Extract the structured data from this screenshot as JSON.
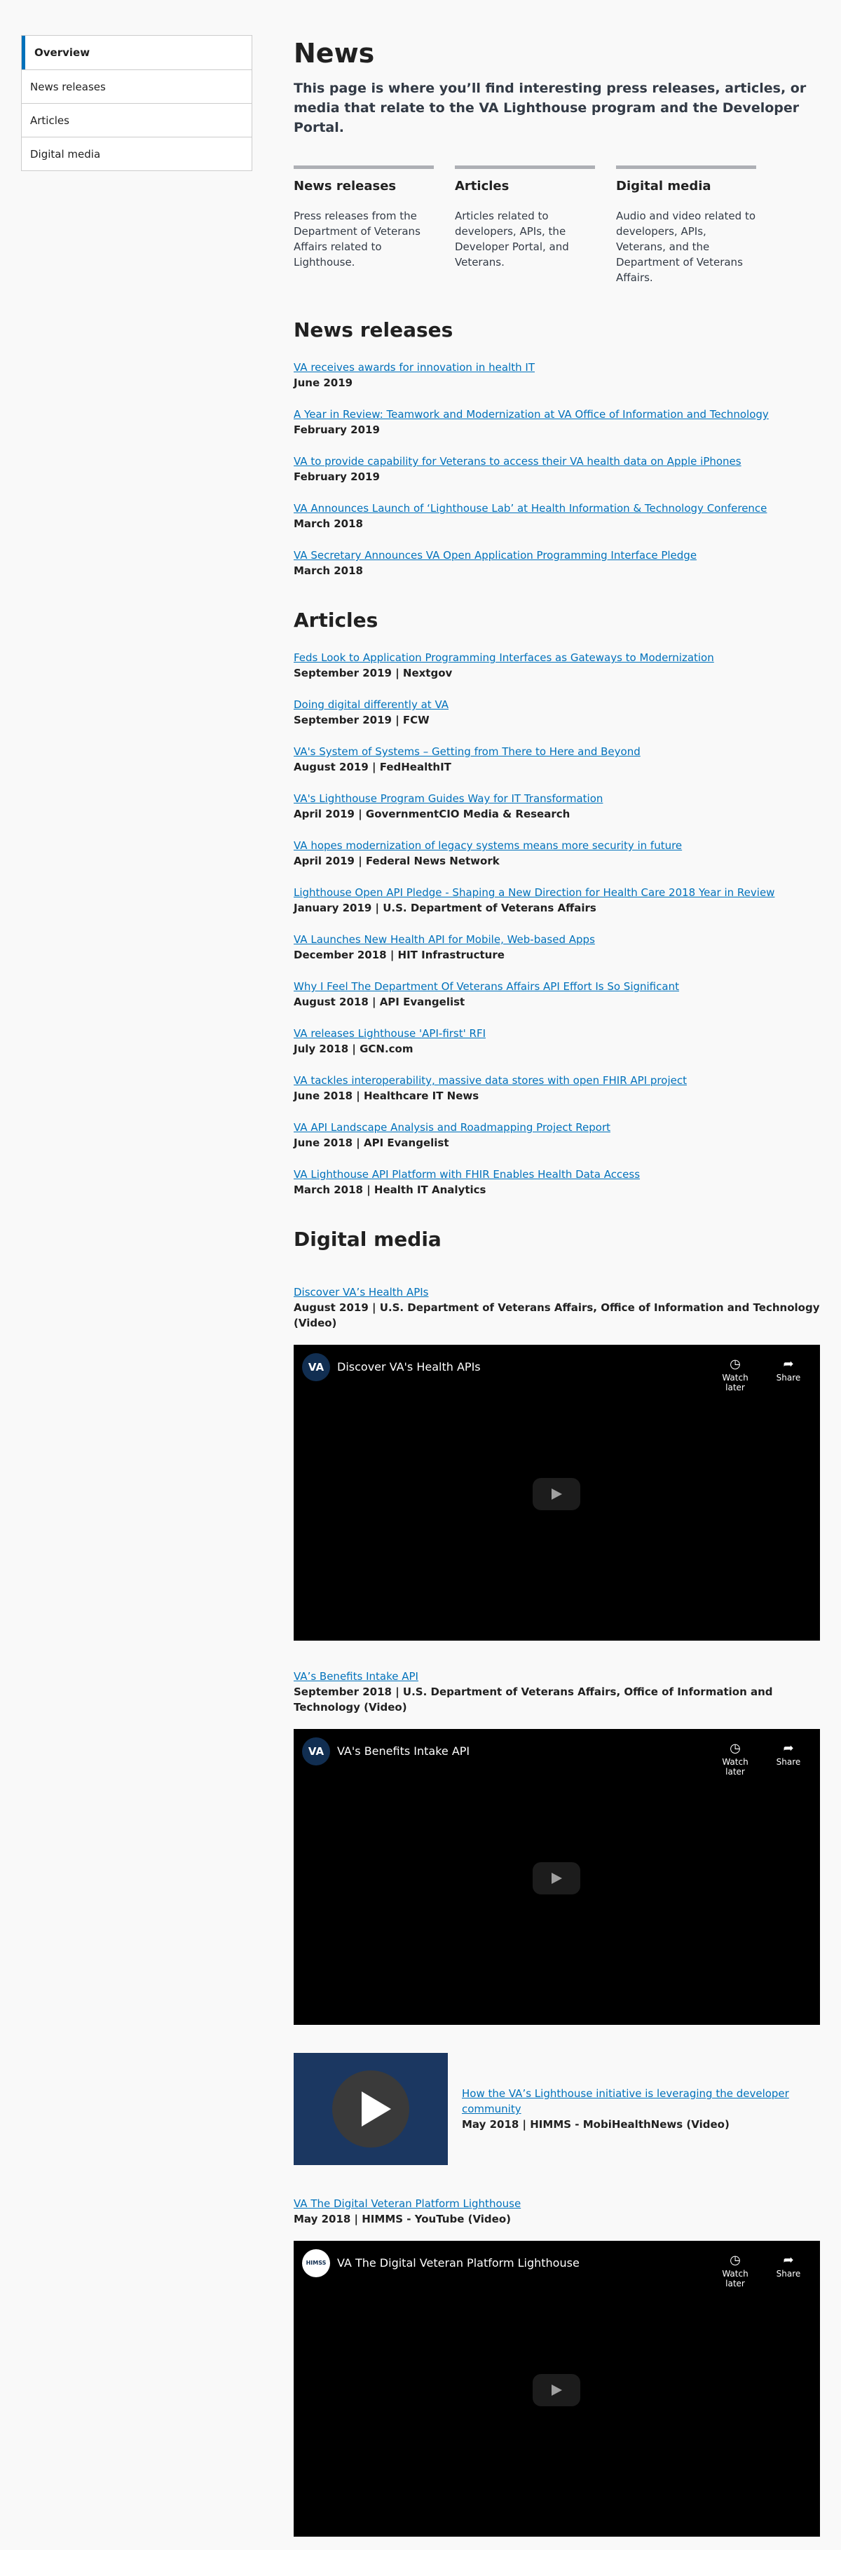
{
  "sidebar": {
    "items": [
      {
        "label": "Overview",
        "active": true
      },
      {
        "label": "News releases"
      },
      {
        "label": "Articles"
      },
      {
        "label": "Digital media"
      }
    ]
  },
  "header": {
    "title": "News",
    "lead": "This page is where you’ll find interesting press releases, articles, or media that relate to the VA Lighthouse program and the Developer Portal."
  },
  "cards": [
    {
      "title": "News releases",
      "desc": "Press releases from the Department of Veterans Affairs related to Lighthouse."
    },
    {
      "title": "Articles",
      "desc": "Articles related to developers, APIs, the Developer Portal, and Veterans."
    },
    {
      "title": "Digital media",
      "desc": "Audio and video related to developers, APIs, Veterans, and the Department of Veterans Affairs."
    }
  ],
  "news": {
    "title": "News releases",
    "items": [
      {
        "link": "VA receives awards for innovation in health IT",
        "meta": "June 2019"
      },
      {
        "link": "A Year in Review: Teamwork and Modernization at VA Office of Information and Technology",
        "meta": "February 2019"
      },
      {
        "link": "VA to provide capability for Veterans to access their VA health data on Apple iPhones",
        "meta": "February 2019"
      },
      {
        "link": "VA Announces Launch of ‘Lighthouse Lab’ at Health Information & Technology Conference",
        "meta": "March 2018"
      },
      {
        "link": "VA Secretary Announces VA Open Application Programming Interface Pledge",
        "meta": "March 2018"
      }
    ]
  },
  "articles": {
    "title": "Articles",
    "items": [
      {
        "link": "Feds Look to Application Programming Interfaces as Gateways to Modernization",
        "meta": "September 2019 | Nextgov"
      },
      {
        "link": "Doing digital differently at VA",
        "meta": "September 2019 | FCW"
      },
      {
        "link": "VA's System of Systems – Getting from There to Here and Beyond",
        "meta": "August 2019 | FedHealthIT"
      },
      {
        "link": "VA's Lighthouse Program Guides Way for IT Transformation",
        "meta": "April 2019 | GovernmentCIO Media & Research"
      },
      {
        "link": "VA hopes modernization of legacy systems means more security in future",
        "meta": "April 2019 | Federal News Network"
      },
      {
        "link": "Lighthouse Open API Pledge - Shaping a New Direction for Health Care 2018 Year in Review",
        "meta": "January 2019 | U.S. Department of Veterans Affairs"
      },
      {
        "link": "VA Launches New Health API for Mobile, Web-based Apps",
        "meta": "December 2018 | HIT Infrastructure"
      },
      {
        "link": "Why I Feel The Department Of Veterans Affairs API Effort Is So Significant",
        "meta": "August 2018 | API Evangelist"
      },
      {
        "link": "VA releases Lighthouse 'API-first' RFI",
        "meta": "July 2018 | GCN.com"
      },
      {
        "link": "VA tackles interoperability, massive data stores with open FHIR API project",
        "meta": "June 2018 | Healthcare IT News"
      },
      {
        "link": "VA API Landscape Analysis and Roadmapping Project Report",
        "meta": "June 2018 | API Evangelist"
      },
      {
        "link": "VA Lighthouse API Platform with FHIR Enables Health Data Access",
        "meta": "March 2018 | Health IT Analytics"
      }
    ]
  },
  "media": {
    "title": "Digital media",
    "watch_later": "Watch later",
    "share": "Share",
    "videos": [
      {
        "link": "Discover VA’s Health APIs",
        "meta": "August 2019 | U.S. Department of Veterans Affairs, Office of Information and Technology (Video)",
        "video_title": "Discover VA's Health APIs",
        "channel_badge": "VA"
      },
      {
        "link": "VA’s Benefits Intake API",
        "meta": "September 2018 | U.S. Department of Veterans Affairs, Office of Information and Technology (Video)",
        "video_title": "VA's Benefits Intake API",
        "channel_badge": "VA"
      }
    ],
    "thumb_item": {
      "link": "How the VA’s Lighthouse initiative is leveraging the developer community",
      "meta": "May 2018 | HIMMS - MobiHealthNews (Video)"
    },
    "last_video": {
      "link": "VA The Digital Veteran Platform Lighthouse",
      "meta": "May 2018 | HIMMS - YouTube (Video)",
      "video_title": "VA The Digital Veteran Platform Lighthouse",
      "channel_badge": "HIMSS"
    }
  }
}
